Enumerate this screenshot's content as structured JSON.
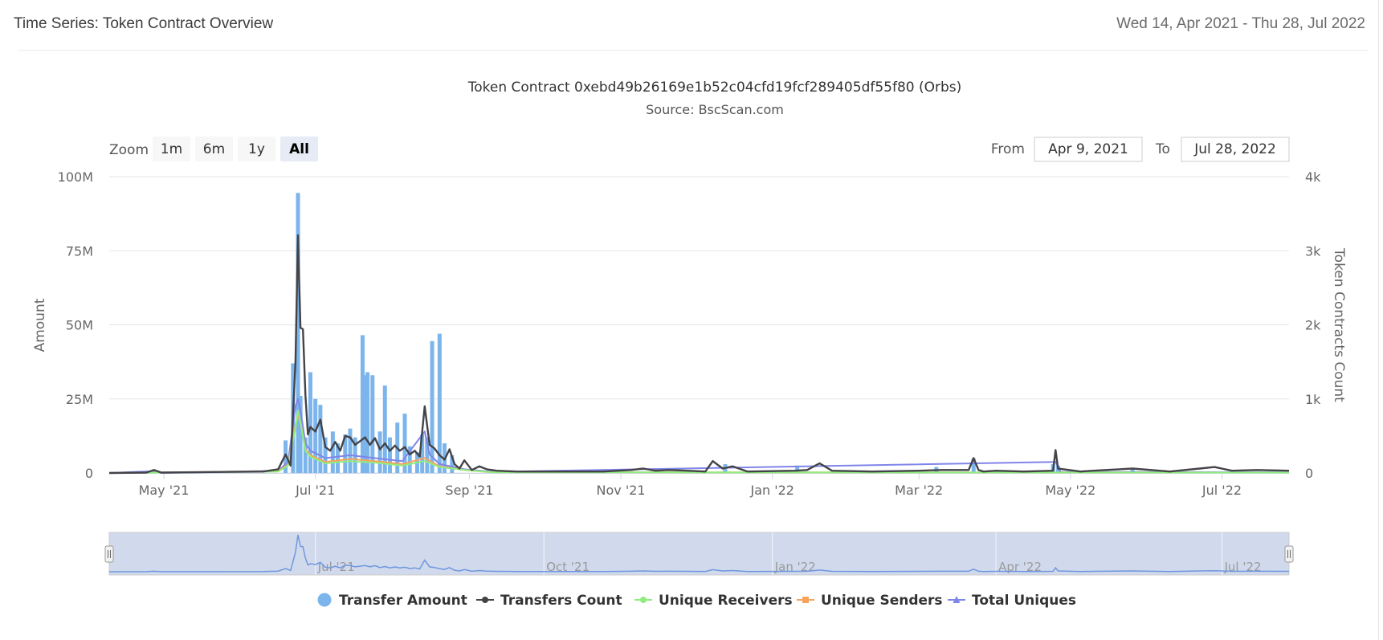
{
  "header": {
    "title": "Time Series: Token Contract Overview",
    "date_range": "Wed 14, Apr 2021 - Thu 28, Jul 2022"
  },
  "chart_data": {
    "type": "bar",
    "title": "Token Contract 0xebd49b26169e1b52c04cfd19fcf289405df55f80 (Orbs)",
    "subtitle": "Source: BscScan.com",
    "zoom": {
      "label": "Zoom",
      "buttons": [
        "1m",
        "6m",
        "1y",
        "All"
      ],
      "selected": "All"
    },
    "range_selector": {
      "from_label": "From",
      "from_value": "Apr 9, 2021",
      "to_label": "To",
      "to_value": "Jul 28, 2022"
    },
    "x_range": [
      "2021-04-09",
      "2022-07-28"
    ],
    "x_ticks": [
      {
        "date": "2021-05-01",
        "label": "May '21"
      },
      {
        "date": "2021-07-01",
        "label": "Jul '21"
      },
      {
        "date": "2021-09-01",
        "label": "Sep '21"
      },
      {
        "date": "2021-11-01",
        "label": "Nov '21"
      },
      {
        "date": "2022-01-01",
        "label": "Jan '22"
      },
      {
        "date": "2022-03-01",
        "label": "Mar '22"
      },
      {
        "date": "2022-05-01",
        "label": "May '22"
      },
      {
        "date": "2022-07-01",
        "label": "Jul '22"
      }
    ],
    "navigator_ticks": [
      {
        "date": "2021-07-01",
        "label": "Jul '21"
      },
      {
        "date": "2021-10-01",
        "label": "Oct '21"
      },
      {
        "date": "2022-01-01",
        "label": "Jan '22"
      },
      {
        "date": "2022-04-01",
        "label": "Apr '22"
      },
      {
        "date": "2022-07-01",
        "label": "Jul '22"
      }
    ],
    "y_left": {
      "label": "Amount",
      "ylim": [
        0,
        100000000
      ],
      "ticks": [
        0,
        25000000,
        50000000,
        75000000,
        100000000
      ],
      "tick_labels": [
        "0",
        "25M",
        "50M",
        "75M",
        "100M"
      ]
    },
    "y_right": {
      "label": "Token Contracts Count",
      "ylim": [
        0,
        4000
      ],
      "ticks": [
        0,
        1000,
        2000,
        3000,
        4000
      ],
      "tick_labels": [
        "0",
        "1k",
        "2k",
        "3k",
        "4k"
      ]
    },
    "grid": true,
    "legend_position": "bottom",
    "series": [
      {
        "name": "Transfer Amount",
        "axis": "left",
        "kind": "column",
        "color": "#7cb5ec",
        "points": [
          [
            "2021-06-19",
            11000000
          ],
          [
            "2021-06-22",
            37000000
          ],
          [
            "2021-06-24",
            94500000
          ],
          [
            "2021-06-25",
            26000000
          ],
          [
            "2021-06-27",
            12000000
          ],
          [
            "2021-06-29",
            34000000
          ],
          [
            "2021-07-01",
            25000000
          ],
          [
            "2021-07-03",
            23000000
          ],
          [
            "2021-07-05",
            12000000
          ],
          [
            "2021-07-08",
            14000000
          ],
          [
            "2021-07-10",
            10000000
          ],
          [
            "2021-07-13",
            13000000
          ],
          [
            "2021-07-15",
            15000000
          ],
          [
            "2021-07-17",
            12000000
          ],
          [
            "2021-07-20",
            46500000
          ],
          [
            "2021-07-21",
            33000000
          ],
          [
            "2021-07-22",
            34000000
          ],
          [
            "2021-07-24",
            33000000
          ],
          [
            "2021-07-27",
            14000000
          ],
          [
            "2021-07-29",
            29500000
          ],
          [
            "2021-07-31",
            12000000
          ],
          [
            "2021-08-03",
            17000000
          ],
          [
            "2021-08-06",
            20000000
          ],
          [
            "2021-08-08",
            9000000
          ],
          [
            "2021-08-11",
            7000000
          ],
          [
            "2021-08-13",
            13000000
          ],
          [
            "2021-08-15",
            12000000
          ],
          [
            "2021-08-17",
            44500000
          ],
          [
            "2021-08-20",
            47000000
          ],
          [
            "2021-08-22",
            10000000
          ],
          [
            "2021-08-25",
            6000000
          ],
          [
            "2021-12-13",
            3000000
          ],
          [
            "2022-01-11",
            2500000
          ],
          [
            "2022-03-08",
            2000000
          ],
          [
            "2022-03-23",
            5000000
          ],
          [
            "2022-04-24",
            3000000
          ],
          [
            "2022-04-26",
            2500000
          ],
          [
            "2022-05-26",
            1500000
          ]
        ]
      },
      {
        "name": "Transfers Count",
        "axis": "right",
        "kind": "line",
        "color": "#434348",
        "points": [
          [
            "2021-04-09",
            0
          ],
          [
            "2021-04-24",
            5
          ],
          [
            "2021-04-27",
            40
          ],
          [
            "2021-04-30",
            5
          ],
          [
            "2021-06-10",
            20
          ],
          [
            "2021-06-16",
            50
          ],
          [
            "2021-06-19",
            250
          ],
          [
            "2021-06-21",
            100
          ],
          [
            "2021-06-23",
            1500
          ],
          [
            "2021-06-24",
            3210
          ],
          [
            "2021-06-25",
            1960
          ],
          [
            "2021-06-26",
            1940
          ],
          [
            "2021-06-27",
            1050
          ],
          [
            "2021-06-28",
            520
          ],
          [
            "2021-06-29",
            620
          ],
          [
            "2021-07-01",
            560
          ],
          [
            "2021-07-03",
            720
          ],
          [
            "2021-07-05",
            350
          ],
          [
            "2021-07-07",
            300
          ],
          [
            "2021-07-09",
            420
          ],
          [
            "2021-07-11",
            300
          ],
          [
            "2021-07-13",
            500
          ],
          [
            "2021-07-15",
            480
          ],
          [
            "2021-07-17",
            380
          ],
          [
            "2021-07-19",
            430
          ],
          [
            "2021-07-21",
            480
          ],
          [
            "2021-07-23",
            380
          ],
          [
            "2021-07-25",
            470
          ],
          [
            "2021-07-27",
            320
          ],
          [
            "2021-07-29",
            400
          ],
          [
            "2021-07-31",
            300
          ],
          [
            "2021-08-02",
            370
          ],
          [
            "2021-08-04",
            300
          ],
          [
            "2021-08-06",
            350
          ],
          [
            "2021-08-08",
            250
          ],
          [
            "2021-08-10",
            300
          ],
          [
            "2021-08-12",
            220
          ],
          [
            "2021-08-14",
            900
          ],
          [
            "2021-08-16",
            380
          ],
          [
            "2021-08-18",
            330
          ],
          [
            "2021-08-20",
            240
          ],
          [
            "2021-08-22",
            180
          ],
          [
            "2021-08-24",
            320
          ],
          [
            "2021-08-26",
            120
          ],
          [
            "2021-08-28",
            60
          ],
          [
            "2021-08-30",
            170
          ],
          [
            "2021-09-02",
            40
          ],
          [
            "2021-09-05",
            90
          ],
          [
            "2021-09-08",
            50
          ],
          [
            "2021-09-12",
            30
          ],
          [
            "2021-09-20",
            20
          ],
          [
            "2021-10-05",
            20
          ],
          [
            "2021-10-25",
            20
          ],
          [
            "2021-11-05",
            40
          ],
          [
            "2021-11-10",
            60
          ],
          [
            "2021-11-15",
            30
          ],
          [
            "2021-11-20",
            40
          ],
          [
            "2021-11-28",
            30
          ],
          [
            "2021-12-05",
            20
          ],
          [
            "2021-12-08",
            160
          ],
          [
            "2021-12-12",
            60
          ],
          [
            "2021-12-16",
            90
          ],
          [
            "2021-12-22",
            20
          ],
          [
            "2022-01-10",
            30
          ],
          [
            "2022-01-15",
            40
          ],
          [
            "2022-01-20",
            130
          ],
          [
            "2022-01-25",
            30
          ],
          [
            "2022-02-10",
            20
          ],
          [
            "2022-03-01",
            30
          ],
          [
            "2022-03-10",
            40
          ],
          [
            "2022-03-21",
            40
          ],
          [
            "2022-03-23",
            200
          ],
          [
            "2022-03-25",
            40
          ],
          [
            "2022-03-27",
            20
          ],
          [
            "2022-04-01",
            30
          ],
          [
            "2022-04-12",
            20
          ],
          [
            "2022-04-24",
            30
          ],
          [
            "2022-04-25",
            310
          ],
          [
            "2022-04-26",
            60
          ],
          [
            "2022-05-05",
            20
          ],
          [
            "2022-05-10",
            30
          ],
          [
            "2022-05-26",
            60
          ],
          [
            "2022-06-10",
            20
          ],
          [
            "2022-06-22",
            60
          ],
          [
            "2022-06-28",
            80
          ],
          [
            "2022-07-05",
            30
          ],
          [
            "2022-07-15",
            40
          ],
          [
            "2022-07-28",
            30
          ]
        ]
      },
      {
        "name": "Unique Receivers",
        "axis": "right",
        "kind": "line",
        "color": "#90ed7d",
        "points": [
          [
            "2021-04-09",
            0
          ],
          [
            "2021-06-16",
            20
          ],
          [
            "2021-06-20",
            100
          ],
          [
            "2021-06-23",
            600
          ],
          [
            "2021-06-24",
            840
          ],
          [
            "2021-06-25",
            680
          ],
          [
            "2021-06-27",
            300
          ],
          [
            "2021-06-29",
            220
          ],
          [
            "2021-07-05",
            130
          ],
          [
            "2021-07-15",
            160
          ],
          [
            "2021-07-25",
            140
          ],
          [
            "2021-08-05",
            100
          ],
          [
            "2021-08-14",
            160
          ],
          [
            "2021-08-20",
            80
          ],
          [
            "2021-08-30",
            40
          ],
          [
            "2021-09-10",
            10
          ],
          [
            "2022-07-28",
            5
          ]
        ]
      },
      {
        "name": "Unique Senders",
        "axis": "right",
        "kind": "line",
        "color": "#f7a35c",
        "points": [
          [
            "2021-04-09",
            0
          ],
          [
            "2021-06-16",
            25
          ],
          [
            "2021-06-20",
            110
          ],
          [
            "2021-06-23",
            640
          ],
          [
            "2021-06-24",
            760
          ],
          [
            "2021-06-25",
            700
          ],
          [
            "2021-06-27",
            320
          ],
          [
            "2021-06-29",
            240
          ],
          [
            "2021-07-05",
            150
          ],
          [
            "2021-07-15",
            190
          ],
          [
            "2021-07-25",
            160
          ],
          [
            "2021-08-05",
            120
          ],
          [
            "2021-08-14",
            200
          ],
          [
            "2021-08-20",
            90
          ],
          [
            "2021-08-30",
            40
          ],
          [
            "2021-09-10",
            10
          ],
          [
            "2022-07-28",
            5
          ]
        ]
      },
      {
        "name": "Total Uniques",
        "axis": "right",
        "kind": "line",
        "color": "#8085e9",
        "points": [
          [
            "2021-04-09",
            0
          ],
          [
            "2021-04-27",
            25
          ],
          [
            "2021-04-30",
            0
          ],
          [
            "2021-06-16",
            30
          ],
          [
            "2021-06-20",
            150
          ],
          [
            "2021-06-23",
            900
          ],
          [
            "2021-06-24",
            1000
          ],
          [
            "2021-06-25",
            850
          ],
          [
            "2021-06-27",
            400
          ],
          [
            "2021-06-29",
            300
          ],
          [
            "2021-07-05",
            200
          ],
          [
            "2021-07-15",
            240
          ],
          [
            "2021-07-25",
            200
          ],
          [
            "2021-08-05",
            160
          ],
          [
            "2021-08-14",
            560
          ],
          [
            "2021-08-16",
            250
          ],
          [
            "2021-08-20",
            120
          ],
          [
            "2021-08-30",
            50
          ],
          [
            "2021-09-10",
            15
          ],
          [
            "2022-04-25",
            150
          ],
          [
            "2022-04-27",
            15
          ],
          [
            "2022-07-28",
            8
          ]
        ]
      }
    ]
  }
}
